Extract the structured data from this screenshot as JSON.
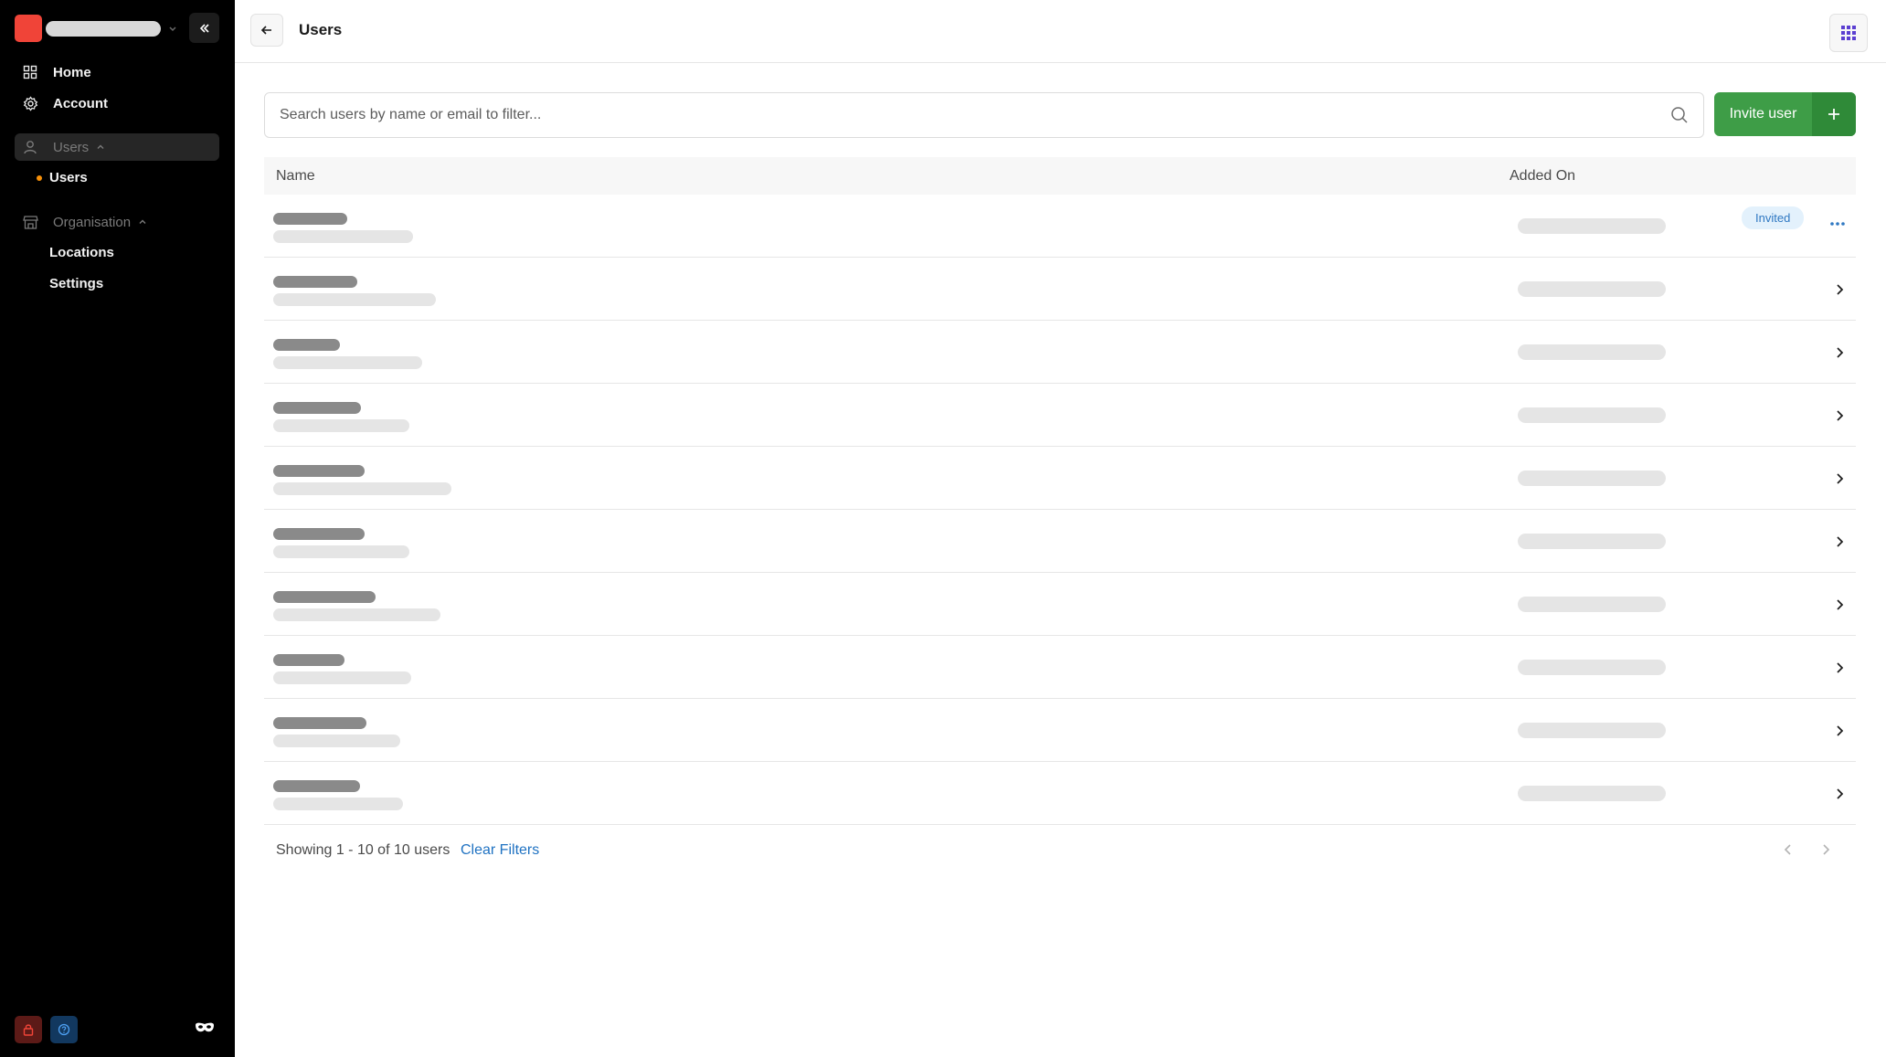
{
  "sidebar": {
    "nav": {
      "home": "Home",
      "account": "Account",
      "users_group": "Users",
      "users_sub": "Users",
      "organisation_group": "Organisation",
      "locations": "Locations",
      "settings": "Settings"
    },
    "icons": [
      "brand-logo",
      "collapse-icon",
      "home-grid-icon",
      "gear-icon",
      "user-icon",
      "store-icon",
      "lock-icon",
      "help-icon",
      "mask-icon"
    ]
  },
  "header": {
    "title": "Users"
  },
  "search": {
    "placeholder": "Search users by name or email to filter...",
    "value": ""
  },
  "actions": {
    "invite_label": "Invite user"
  },
  "table": {
    "columns": {
      "name": "Name",
      "added_on": "Added On"
    },
    "rows_loading": 10,
    "first_row_badge": "Invited"
  },
  "footer": {
    "result_info": "Showing 1 - 10 of 10 users",
    "clear_filters": "Clear Filters"
  },
  "colors": {
    "sidebar_bg": "#000000",
    "brand_red": "#f04438",
    "accent_green": "#3e9d47",
    "link_blue": "#1f72c2",
    "apps_icon_purple": "#5b3fd1",
    "badge_bg": "#e3f1fc"
  }
}
